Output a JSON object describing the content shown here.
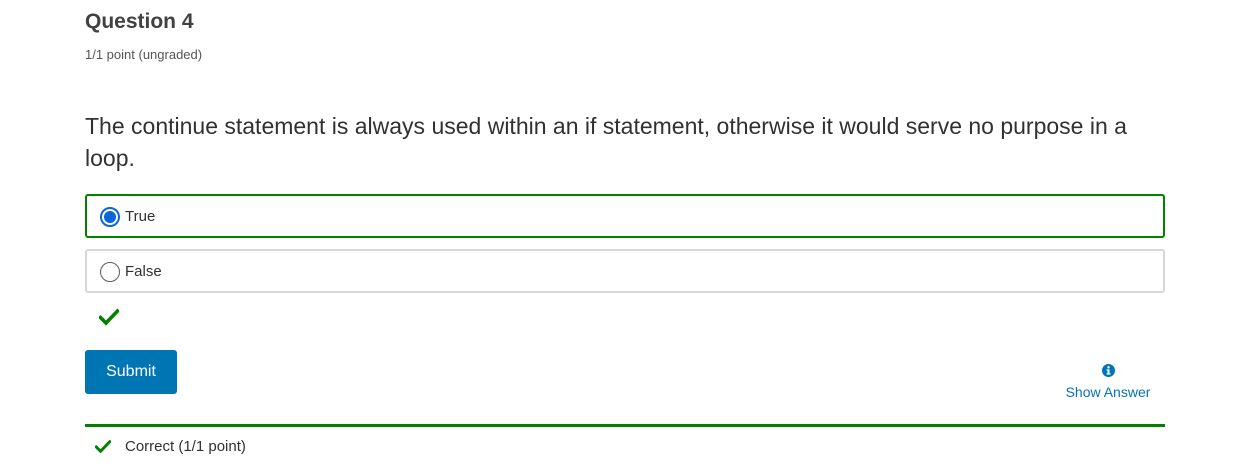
{
  "problem": {
    "title": "Question 4",
    "points": "1/1 point (ungraded)",
    "question": "The continue statement is always used within an if statement, otherwise it would serve no purpose in a loop.",
    "choices": [
      {
        "label": "True",
        "selected": true
      },
      {
        "label": "False",
        "selected": false
      }
    ],
    "status_icon": "checkmark-icon",
    "submit_label": "Submit",
    "show_answer_icon": "info-icon",
    "show_answer_label": "Show Answer",
    "notification_icon": "checkmark-icon",
    "notification_text": "Correct (1/1 point)"
  },
  "colors": {
    "correct": "#008100",
    "accent": "#0075b4",
    "radio_selected": "#0a67d8",
    "border": "#d7d7d7",
    "text": "#313131"
  }
}
